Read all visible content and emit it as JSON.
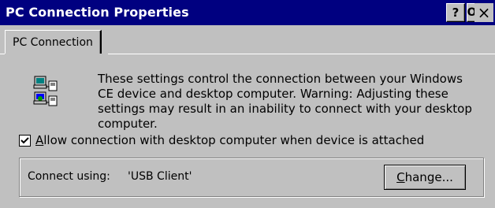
{
  "window": {
    "title": "PC Connection Properties",
    "help_label": "?",
    "ok_label": "OK",
    "close_label": "×"
  },
  "tabs": [
    {
      "label": "PC Connection",
      "selected": true
    }
  ],
  "description": "These settings control the connection between your Windows\nCE device and desktop computer.  Warning: Adjusting these\nsettings may result in an inability to connect with your desktop\ncomputer.",
  "checkbox": {
    "mnemonic": "A",
    "label_rest": "llow connection with desktop computer when device is attached",
    "checked": true
  },
  "connection": {
    "label": "Connect using:",
    "value": "'USB Client'",
    "change_mnemonic": "C",
    "change_rest": "hange..."
  },
  "icons": {
    "titlebar_close": "close-icon",
    "pc_connection": "pc-connection-icon",
    "check": "checkmark-icon"
  },
  "colors": {
    "titlebar": "#000080",
    "face": "#c0c0c0"
  }
}
